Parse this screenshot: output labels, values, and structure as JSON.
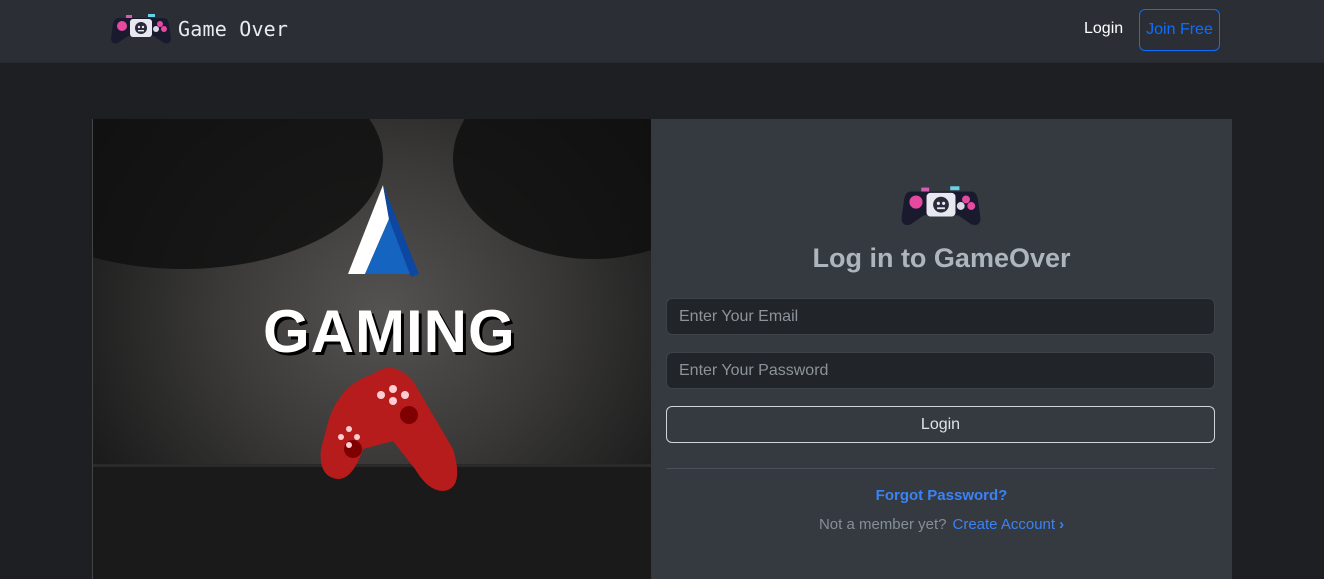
{
  "navbar": {
    "brand_name": "Game Over",
    "login_label": "Login",
    "join_label": "Join Free"
  },
  "hero": {
    "logo_text": "GAMING"
  },
  "login_form": {
    "title": "Log in to GameOver",
    "email_placeholder": "Enter Your Email",
    "password_placeholder": "Enter Your Password",
    "submit_label": "Login",
    "forgot_label": "Forgot Password?",
    "member_prompt": "Not a member yet?",
    "create_account_label": "Create Account",
    "chevron_icon": "chevron-right-icon"
  },
  "colors": {
    "primary": "#0d6efd",
    "link": "#3b82f6",
    "navbar_bg": "#2b2f35",
    "page_bg": "#1d1f23",
    "panel_bg": "#343a40",
    "input_bg": "#212529"
  }
}
